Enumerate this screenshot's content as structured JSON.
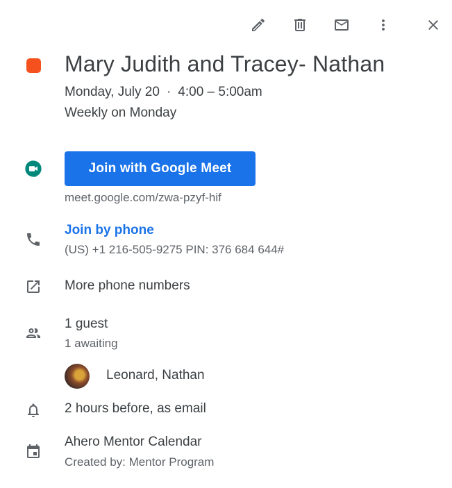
{
  "toolbar": {
    "edit_icon": "pencil-icon",
    "delete_icon": "trash-icon",
    "email_icon": "mail-icon",
    "more_icon": "more-vert-icon",
    "close_icon": "close-icon"
  },
  "event": {
    "color": "#f4511e",
    "title": "Mary Judith and Tracey- Nathan",
    "date": "Monday, July 20",
    "separator": "·",
    "time": "4:00 – 5:00am",
    "recurrence": "Weekly on Monday"
  },
  "meet": {
    "button_label": "Join with Google Meet",
    "button_color": "#1a73e8",
    "link": "meet.google.com/zwa-pzyf-hif"
  },
  "phone": {
    "label": "Join by phone",
    "label_color": "#1a73e8",
    "details": "(US) +1 216-505-9275 PIN: 376 684 644#"
  },
  "more_numbers": {
    "label": "More phone numbers"
  },
  "guests": {
    "count": "1 guest",
    "awaiting": "1 awaiting",
    "list": [
      {
        "name": "Leonard, Nathan"
      }
    ]
  },
  "reminder": {
    "text": "2 hours before, as email"
  },
  "calendar": {
    "name": "Ahero Mentor Calendar",
    "created_by": "Created by: Mentor Program"
  }
}
